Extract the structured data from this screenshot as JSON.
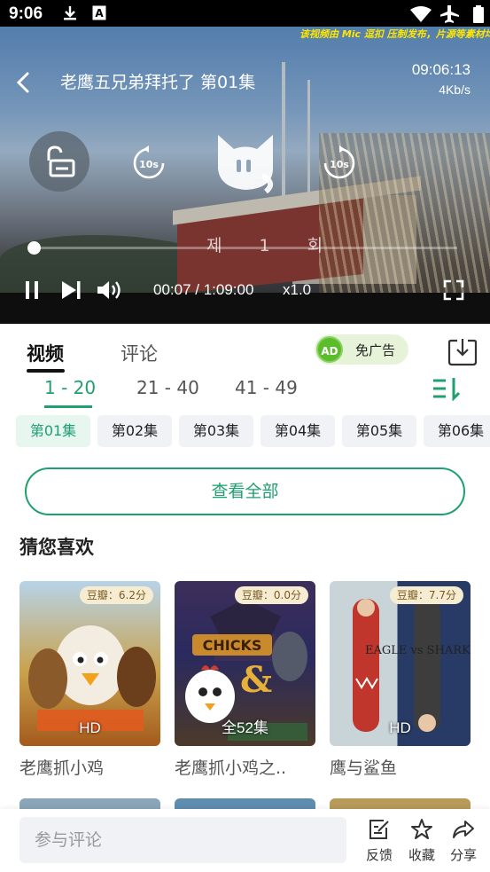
{
  "status_bar": {
    "time": "9:06",
    "icons": [
      "download-icon",
      "a-notification-icon",
      "wifi-icon",
      "airplane-icon",
      "battery-icon"
    ]
  },
  "player": {
    "ticker": "该视频由 Mic 逗扣 压制发布，片源等素材均",
    "title": "老鹰五兄弟拜托了 第01集",
    "clock": "09:06:13",
    "net_speed": "4Kb/s",
    "rewind_label": "10s",
    "forward_label": "10s",
    "episode_watermark": "제 1 회",
    "current_time": "00:07",
    "duration": "1:09:00",
    "time_separator": " / ",
    "playback_rate": "x1.0",
    "progress_fraction": 0.002
  },
  "tabs": {
    "video": "视频",
    "comments": "评论"
  },
  "ad_toggle": {
    "badge": "AD",
    "label": "免广告"
  },
  "ranges": [
    "1 - 20",
    "21 - 40",
    "41 - 49"
  ],
  "episodes": [
    "第01集",
    "第02集",
    "第03集",
    "第04集",
    "第05集",
    "第06集"
  ],
  "view_all": "查看全部",
  "recommend": {
    "title": "猜您喜欢",
    "items": [
      {
        "name": "老鹰抓小鸡",
        "rating": "豆瓣：6.2分",
        "badge": "HD"
      },
      {
        "name": "老鹰抓小鸡之..",
        "rating": "豆瓣：0.0分",
        "badge": "全52集"
      },
      {
        "name": "鹰与鲨鱼",
        "rating": "豆瓣：7.7分",
        "badge": "HD"
      }
    ]
  },
  "bottom_bar": {
    "comment_placeholder": "参与评论",
    "feedback": "反馈",
    "favorite": "收藏",
    "share": "分享"
  },
  "colors": {
    "accent": "#1fa06f",
    "ad_green": "#5bbd2b"
  }
}
